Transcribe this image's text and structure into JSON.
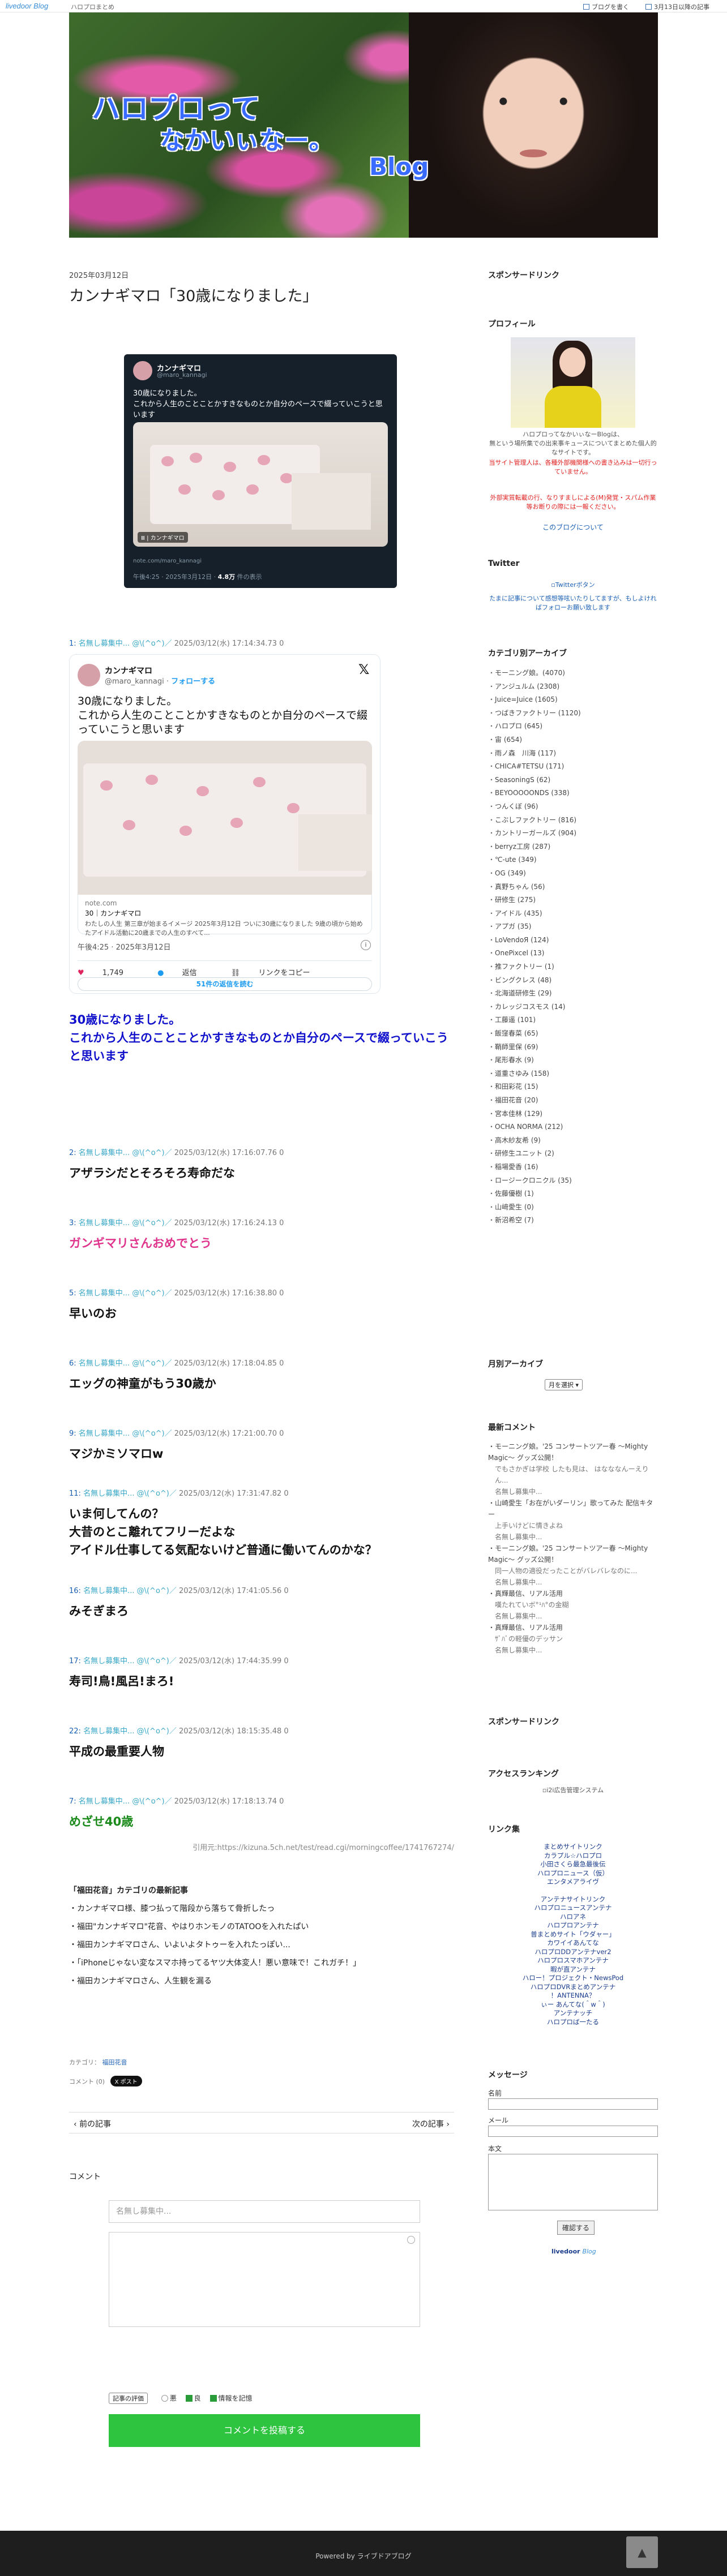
{
  "topbar": {
    "logo_main": "livedoor",
    "logo_sub": "Blog",
    "site_name": "ハロプロまとめ",
    "write_label": "ブログを書く",
    "latest_label": "3月13日以降の記事"
  },
  "header": {
    "title_line1": "ハロプロって",
    "title_line2": "なかいぃなー。",
    "title_line3": "Blog"
  },
  "post": {
    "date": "2025年03月12日",
    "title": "カンナギマロ「30歳になりました」",
    "tweet_image": {
      "name": "カンナギマロ",
      "handle": "@maro_kannagi",
      "text": "30歳になりました。\nこれから人生のことことかすきなものとか自分のペースで綴っていこうと思います",
      "badge": "Ⅲ | カンナギマロ",
      "source": "note.com/maro_kannagi",
      "footer": "午後4:25 · 2025年3月12日 · ",
      "views": "4.8万",
      "views_label": "件の表示"
    },
    "comments": [
      {
        "num": "1:",
        "name": "名無し募集中...",
        "face": "@\\(^o^)／",
        "date": "2025/03/12(水) 17:14:34.73 0",
        "embed": {
          "name": "カンナギマロ",
          "handle": "@maro_kannagi",
          "follow": "フォローする",
          "text": "30歳になりました。\nこれから人生のことことかすきなものとか自分のペースで綴っていこうと思います",
          "card_domain": "note.com",
          "card_title": "30｜カンナギマロ",
          "card_snippet": "わたしの人生 第三章が始まるイメージ 2025年3月12日 ついに30歳になりました 9歳の頃から始めたアイドル活動に20歳までの人生のすべて...",
          "time": "午後4:25 · 2025年3月12日",
          "likes": "1,749",
          "reply": "返信",
          "copy": "リンクをコピー",
          "more": "51件の返信を読む"
        },
        "quote": "30歳になりました。\nこれから人生のことことかすきなものとか自分のペースで綴っていこうと思います"
      },
      {
        "num": "2:",
        "name": "名無し募集中...",
        "face": "@\\(^o^)／",
        "date": "2025/03/12(水) 17:16:07.76 0",
        "body": "アザラシだとそろそろ寿命だな",
        "color": "#111111"
      },
      {
        "num": "3:",
        "name": "名無し募集中...",
        "face": "@\\(^o^)／",
        "date": "2025/03/12(水) 17:16:24.13 0",
        "body": "ガンギマリさんおめでとう",
        "color": "#e0348c"
      },
      {
        "num": "5:",
        "name": "名無し募集中...",
        "face": "@\\(^o^)／",
        "date": "2025/03/12(水) 17:16:38.80 0",
        "body": "早いのお",
        "color": "#111111"
      },
      {
        "num": "6:",
        "name": "名無し募集中...",
        "face": "@\\(^o^)／",
        "date": "2025/03/12(水) 17:18:04.85 0",
        "body": "エッグの神童がもう30歳か",
        "color": "#111111"
      },
      {
        "num": "9:",
        "name": "名無し募集中...",
        "face": "@\\(^o^)／",
        "date": "2025/03/12(水) 17:21:00.70 0",
        "body": "マジかミソマロw",
        "color": "#111111"
      },
      {
        "num": "11:",
        "name": "名無し募集中...",
        "face": "@\\(^o^)／",
        "date": "2025/03/12(水) 17:31:47.82 0",
        "body": "いま何してんの？\n大昔のとこ離れてフリーだよな\nアイドル仕事してる気配ないけど普通に働いてんのかな？",
        "color": "#111111"
      },
      {
        "num": "16:",
        "name": "名無し募集中...",
        "face": "@\\(^o^)／",
        "date": "2025/03/12(水) 17:41:05.56 0",
        "body": "みそぎまろ",
        "color": "#111111"
      },
      {
        "num": "17:",
        "name": "名無し募集中...",
        "face": "@\\(^o^)／",
        "date": "2025/03/12(水) 17:44:35.99 0",
        "body": "寿司!鳥!風呂!まろ!",
        "color": "#111111"
      },
      {
        "num": "22:",
        "name": "名無し募集中...",
        "face": "@\\(^o^)／",
        "date": "2025/03/12(水) 18:15:35.48 0",
        "body": "平成の最重要人物",
        "color": "#111111"
      },
      {
        "num": "7:",
        "name": "名無し募集中...",
        "face": "@\\(^o^)／",
        "date": "2025/03/12(水) 17:18:13.74 0",
        "body": "めざせ40歳",
        "color": "#1a8a1a"
      }
    ],
    "source": "引用元:https://kizuna.5ch.net/test/read.cgi/morningcoffee/1741767274/",
    "related_title": "「福田花音」カテゴリの最新記事",
    "related": [
      "カンナギマロ様、膝つ払って階段から落ちて骨折したっ",
      "福田\"カンナギマロ\"花音、やはりホンモノのTATOOを入れたぱい",
      "福田カンナギマロさん、いよいよタトゥーを入れたっぽい...",
      "「iPhoneじゃない変なスマホ持ってるヤツ大体変人！悪い意味で！これガチ！」",
      "福田カンナギマロさん、人生観を漏る"
    ],
    "category_label": "カテゴリ：",
    "category_link": "福田花音",
    "comment_count_label": "コメント",
    "comment_count": "(0)",
    "xpost": "X ポスト",
    "prev": "前の記事",
    "next": "次の記事"
  },
  "comment_form": {
    "title": "コメント",
    "name_placeholder": "名無し募集中...",
    "eval_label": "記事の評価",
    "good_label": "良",
    "remember_label": "情報を記憶",
    "submit": "コメントを投稿する"
  },
  "sidebar": {
    "sponsored": "スポンサードリンク",
    "profile": "プロフィール",
    "profile_name": "ハロプロってなかいぃなーBlogは、\n無という場所集での出来事キュースについてまとめた個人的なサイトです。",
    "profile_red": "当サイト管理人は、各種外部機関様への書き込みは一切行っていません。",
    "profile_red2": "外部実質転載の行、なりすましによる(M)発覚・スパム作業等お断りの際には一報ください。",
    "profile_link": "このブログについて",
    "twitter": "Twitter",
    "twitter_button": "Twitterボタン",
    "twitter_text": "たまに記事について感想等呟いたりしてますが、もしよければフォローお願い致します",
    "categories_title": "カテゴリ別アーカイブ",
    "categories": [
      "モーニング娘。(4070)",
      "アンジュルム (2308)",
      "Juice=Juice (1605)",
      "つばきファクトリー (1120)",
      "ハロプロ (645)",
      "宙 (654)",
      "雨ノ森　川海 (117)",
      "CHICA#TETSU (171)",
      "SeasoningS (62)",
      "BEYOOOOONDS (338)",
      "つんくぼ (96)",
      "こぶしファクトリー (816)",
      "カントリーガールズ (904)",
      "berryz工房 (287)",
      "℃-ute (349)",
      "OG (349)",
      "真野ちゃん (56)",
      "研修生 (275)",
      "アイドル (435)",
      "アプガ (35)",
      "LoVendoЯ (124)",
      "OnePixcel (13)",
      "推ファクトリー (1)",
      "ビングクレス (48)",
      "北海道研修生 (29)",
      "カレッジコスモス (14)",
      "工藤遥 (101)",
      "飯窪春菜 (65)",
      "鞘師里保 (69)",
      "尾形春水 (9)",
      "道重さゆみ (158)",
      "和田彩花 (15)",
      "福田花音 (20)",
      "宮本佳林 (129)",
      "OCHA NORMA (212)",
      "高木紗友希 (9)",
      "研修生ユニット (2)",
      "稲場愛香 (16)",
      "ロージークロニクル (35)",
      "佐藤優樹 (1)",
      "山﨑愛生 (0)",
      "新沼希空 (7)"
    ],
    "monthly_title": "月別アーカイブ",
    "monthly_select": "月を選択",
    "recent_title": "最新コメント",
    "recent": [
      {
        "t": "モーニング娘。'25 コンサートツアー春 ～Mighty Magic～ グッズ公開！",
        "w": "でもさかぎは学校 したも見は、 はなななんーえりん..."
      },
      {
        "t": "",
        "w": "名無し募集中..."
      },
      {
        "t": "山崎愛生「お在がいダーリン」歌ってみた 配信キター",
        "w": "上手いけどに情きよね"
      },
      {
        "t": "",
        "w": "名無し募集中..."
      },
      {
        "t": "モーニング娘。'25 コンサートツアー春 ～Mighty Magic～ グッズ公開！",
        "w": "同一人物の適役だったことがバレバレなのに..."
      },
      {
        "t": "",
        "w": "名無し募集中..."
      },
      {
        "t": "真輝最信、リアル活用",
        "w": "嘆たれていボ°¹ﾊ°の金糊"
      },
      {
        "t": "",
        "w": "名無し募集中..."
      },
      {
        "t": "真輝最信、リアル活用",
        "w": "ｻﾞﾊﾞの軽優のデッサン"
      },
      {
        "t": "",
        "w": "名無し募集中..."
      }
    ],
    "sponsored2": "スポンサードリンク",
    "access_title": "アクセスランキング",
    "access_img": "i2i広告管理システム",
    "links_title": "リンク集",
    "links": [
      "まとめサイトリンク",
      "カラプル☆ハロプロ",
      "小田さくら最急最後伝",
      "ハロプロニュース（仮）",
      "エンタメアライヴ",
      "",
      "アンテナサイトリンク",
      "ハロプロニュースアンテナ",
      "ハロアネ",
      "ハロプロアンテナ",
      "普まとめサイト「ウダャー」",
      "カワイイあんてな",
      "ハロプロDDアンテナver2",
      "ハロプロスマホアンテナ",
      "暇が直アンテナ",
      "ハロー！プロジェクト・NewsPod",
      "ハロプロDVRまとめアンテナ",
      "！ANTENNA？",
      "ぃー あんてな(＾w＾)",
      "アンテナッチ",
      "ハロプロば一たる"
    ],
    "message_title": "メッセージ",
    "message_name": "名前",
    "message_mail": "メール",
    "message_body": "本文",
    "message_button": "確認する",
    "livedoor_logo": "livedoor",
    "livedoor_blog": "Blog"
  },
  "footer": {
    "powered": "Powered by ライブドアブログ",
    "up": "▲"
  }
}
